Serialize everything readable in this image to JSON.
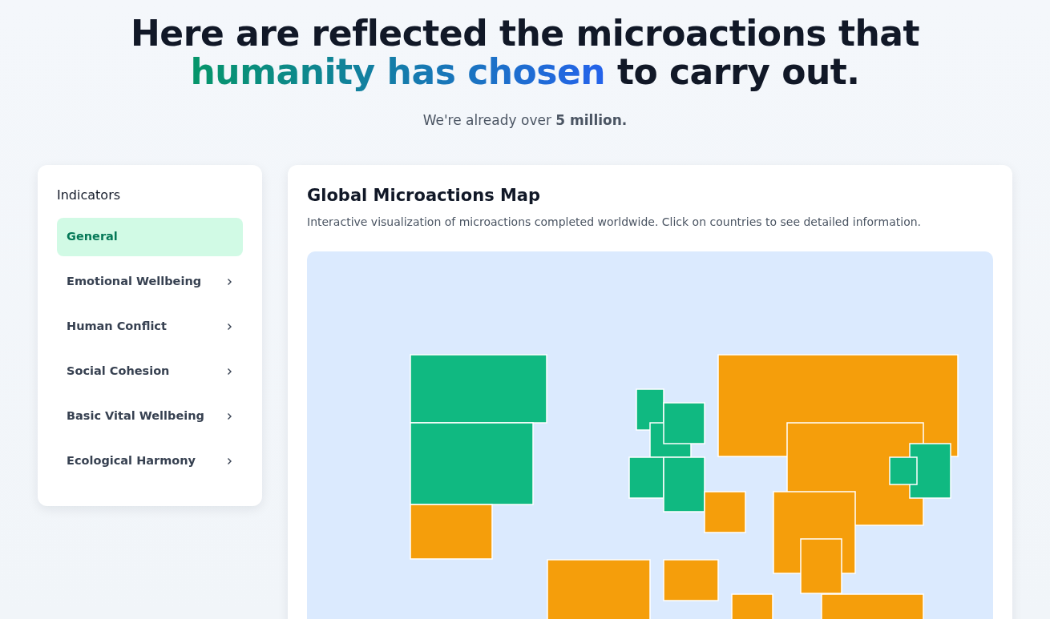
{
  "hero": {
    "title_start": "Here are reflected the microactions that ",
    "title_highlight": "humanity has chosen",
    "title_end": " to carry out.",
    "subtitle": "We're already over **5 million.**"
  },
  "sidebar": {
    "title": "Indicators",
    "items": [
      {
        "label": "General",
        "selected": true,
        "has_submenu": false
      },
      {
        "label": "Emotional Wellbeing",
        "selected": false,
        "has_submenu": true
      },
      {
        "label": "Human Conflict",
        "selected": false,
        "has_submenu": true
      },
      {
        "label": "Social Cohesion",
        "selected": false,
        "has_submenu": true
      },
      {
        "label": "Basic Vital Wellbeing",
        "selected": false,
        "has_submenu": true
      },
      {
        "label": "Ecological Harmony",
        "selected": false,
        "has_submenu": true
      }
    ]
  },
  "map_panel": {
    "title": "Global Microactions Map",
    "description": "Interactive visualization of microactions completed worldwide. Click on countries to see detailed information."
  }
}
